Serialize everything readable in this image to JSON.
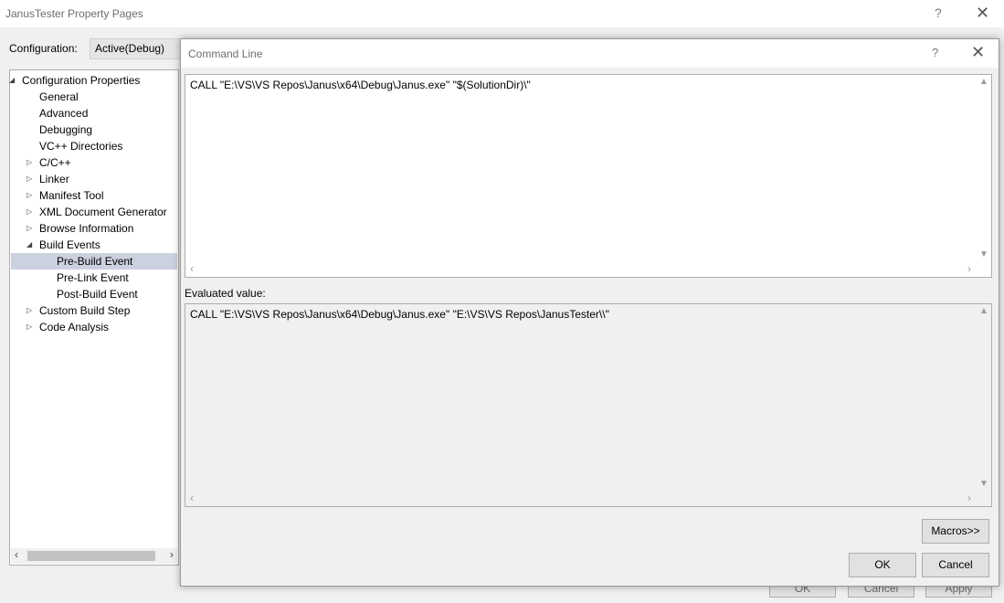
{
  "window": {
    "title": "JanusTester Property Pages",
    "help_glyph": "?",
    "close_glyph": "✕"
  },
  "config": {
    "label": "Configuration:",
    "value": "Active(Debug)"
  },
  "tree": {
    "items": [
      {
        "label": "Configuration Properties",
        "level": 0,
        "expand": "expanded"
      },
      {
        "label": "General",
        "level": 1,
        "expand": "none"
      },
      {
        "label": "Advanced",
        "level": 1,
        "expand": "none"
      },
      {
        "label": "Debugging",
        "level": 1,
        "expand": "none"
      },
      {
        "label": "VC++ Directories",
        "level": 1,
        "expand": "none"
      },
      {
        "label": "C/C++",
        "level": 1,
        "expand": "collapsed"
      },
      {
        "label": "Linker",
        "level": 1,
        "expand": "collapsed"
      },
      {
        "label": "Manifest Tool",
        "level": 1,
        "expand": "collapsed"
      },
      {
        "label": "XML Document Generator",
        "level": 1,
        "expand": "collapsed"
      },
      {
        "label": "Browse Information",
        "level": 1,
        "expand": "collapsed"
      },
      {
        "label": "Build Events",
        "level": 1,
        "expand": "expanded"
      },
      {
        "label": "Pre-Build Event",
        "level": 2,
        "expand": "none",
        "selected": true
      },
      {
        "label": "Pre-Link Event",
        "level": 2,
        "expand": "none"
      },
      {
        "label": "Post-Build Event",
        "level": 2,
        "expand": "none"
      },
      {
        "label": "Custom Build Step",
        "level": 1,
        "expand": "collapsed"
      },
      {
        "label": "Code Analysis",
        "level": 1,
        "expand": "collapsed"
      }
    ]
  },
  "outer_buttons": {
    "ok": "OK",
    "cancel": "Cancel",
    "apply": "Apply"
  },
  "dialog": {
    "title": "Command Line",
    "help_glyph": "?",
    "close_glyph": "✕",
    "command_text": "CALL \"E:\\VS\\VS Repos\\Janus\\x64\\Debug\\Janus.exe\" \"$(SolutionDir)\\\"",
    "evaluated_label": "Evaluated value:",
    "evaluated_text": "CALL \"E:\\VS\\VS Repos\\Janus\\x64\\Debug\\Janus.exe\" \"E:\\VS\\VS Repos\\JanusTester\\\\\"",
    "macros_label": "Macros>>",
    "ok_label": "OK",
    "cancel_label": "Cancel"
  }
}
